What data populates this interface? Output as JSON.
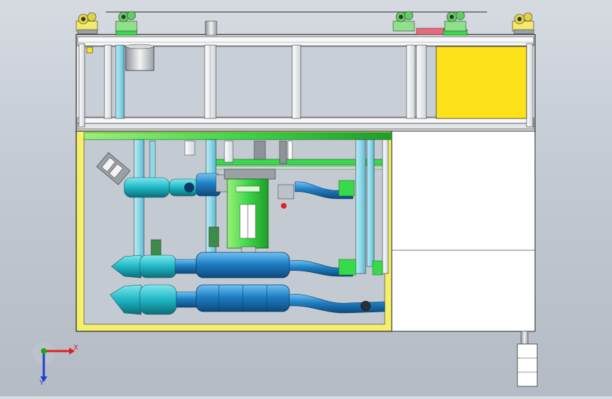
{
  "viewport": {
    "background_top": "#d6dbe2",
    "background_bottom": "#b4bbc5"
  },
  "colors": {
    "frame_outline": "#222222",
    "frame_white": "#f4f5f6",
    "yellow_panel": "#fde21a",
    "yellow_frame": "#f5ef6a",
    "light_blue_column": "#8fd8e8",
    "green_member": "#38d94a",
    "pipe_blue": "#1f7fc4",
    "catalyst_cyan": "#1fb7c6",
    "red_accent": "#e02020",
    "cabinet_white": "#ffffff"
  },
  "model": {
    "top_wheels": [
      "wheel-left",
      "wheel-mid-1",
      "wheel-mid-2",
      "wheel-mid-3",
      "wheel-right"
    ],
    "exhaust_lines": [
      "upper-line",
      "middle-line",
      "lower-line"
    ]
  },
  "triad": {
    "x_label": "X",
    "y_label": "Y",
    "x_color": "#e02020",
    "y_color": "#1aa51a",
    "z_color": "#1b3fd1"
  }
}
